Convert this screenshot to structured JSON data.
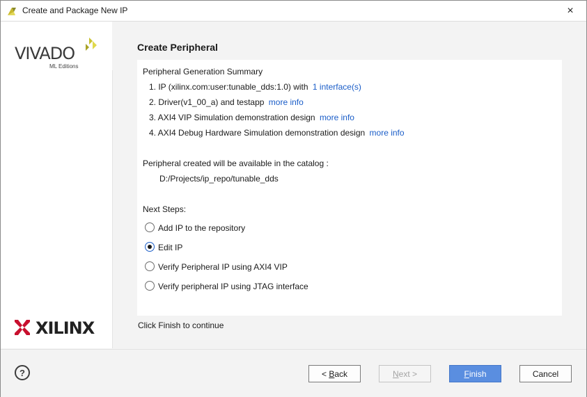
{
  "window": {
    "title": "Create and Package New IP",
    "close_icon": "×"
  },
  "brand": {
    "product": "VIVADO",
    "edition": "ML Editions",
    "vendor": "XILINX"
  },
  "page": {
    "heading": "Create Peripheral",
    "finish_note": "Click Finish to continue"
  },
  "summary": {
    "title": "Peripheral Generation Summary",
    "items": [
      {
        "text": "1. IP (xilinx.com:user:tunable_dds:1.0) with",
        "link": "1 interface(s)"
      },
      {
        "text": "2. Driver(v1_00_a) and testapp",
        "link": "more info"
      },
      {
        "text": "3. AXI4 VIP Simulation demonstration design",
        "link": "more info"
      },
      {
        "text": "4. AXI4 Debug Hardware Simulation demonstration design",
        "link": "more info"
      }
    ],
    "catalog_label": "Peripheral created will be available in the catalog :",
    "catalog_path": "D:/Projects/ip_repo/tunable_dds"
  },
  "next_steps": {
    "label": "Next Steps:",
    "options": [
      {
        "label": "Add IP to the repository",
        "selected": false
      },
      {
        "label": "Edit IP",
        "selected": true
      },
      {
        "label": "Verify Peripheral IP using AXI4 VIP",
        "selected": false
      },
      {
        "label": "Verify peripheral IP using JTAG interface",
        "selected": false
      }
    ]
  },
  "footer": {
    "help": "?",
    "back": {
      "prefix": "< ",
      "mnemonic": "B",
      "rest": "ack"
    },
    "next": {
      "mnemonic": "N",
      "rest": "ext >"
    },
    "finish": {
      "mnemonic": "F",
      "rest": "inish"
    },
    "cancel": "Cancel"
  },
  "colors": {
    "link": "#1a5dc8",
    "primary_button": "#5a8ee0",
    "xilinx_red": "#c8102e",
    "vivado_yellow": "#c9c230"
  }
}
